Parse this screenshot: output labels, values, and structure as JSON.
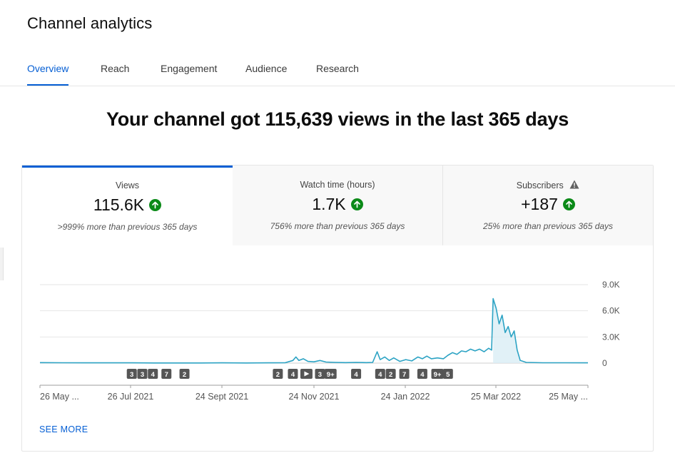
{
  "page": {
    "title": "Channel analytics"
  },
  "tabs": [
    {
      "label": "Overview",
      "active": true
    },
    {
      "label": "Reach",
      "active": false
    },
    {
      "label": "Engagement",
      "active": false
    },
    {
      "label": "Audience",
      "active": false
    },
    {
      "label": "Research",
      "active": false
    }
  ],
  "headline": "Your channel got 115,639 views in the last 365 days",
  "metrics": [
    {
      "label": "Views",
      "value": "115.6K",
      "trend": "up",
      "comparison": ">999% more than previous 365 days",
      "warning": false
    },
    {
      "label": "Watch time (hours)",
      "value": "1.7K",
      "trend": "up",
      "comparison": "756% more than previous 365 days",
      "warning": false
    },
    {
      "label": "Subscribers",
      "value": "+187",
      "trend": "up",
      "comparison": "25% more than previous 365 days",
      "warning": true
    }
  ],
  "colors": {
    "accent": "#065fd4",
    "line": "#2ca3c4",
    "trend_up": "#0b8a18",
    "marker_bg": "#555555"
  },
  "chart_data": {
    "type": "line",
    "metric": "Views",
    "x_tick_labels": [
      "26 May ...",
      "26 Jul 2021",
      "24 Sept 2021",
      "24 Nov 2021",
      "24 Jan 2022",
      "25 Mar 2022",
      "25 May ..."
    ],
    "y_tick_labels": [
      "9.0K",
      "6.0K",
      "3.0K",
      "0"
    ],
    "ylim": [
      0,
      9000
    ],
    "grid": true,
    "x_start": "2021-05-26",
    "x_end": "2022-05-25",
    "series": [
      {
        "points": [
          [
            "2021-05-26",
            60
          ],
          [
            "2021-06-10",
            40
          ],
          [
            "2021-06-25",
            30
          ],
          [
            "2021-07-10",
            30
          ],
          [
            "2021-07-26",
            30
          ],
          [
            "2021-08-10",
            20
          ],
          [
            "2021-08-25",
            20
          ],
          [
            "2021-09-10",
            20
          ],
          [
            "2021-09-24",
            30
          ],
          [
            "2021-10-10",
            20
          ],
          [
            "2021-10-25",
            30
          ],
          [
            "2021-11-05",
            50
          ],
          [
            "2021-11-10",
            300
          ],
          [
            "2021-11-12",
            700
          ],
          [
            "2021-11-14",
            300
          ],
          [
            "2021-11-17",
            500
          ],
          [
            "2021-11-20",
            200
          ],
          [
            "2021-11-24",
            150
          ],
          [
            "2021-11-28",
            300
          ],
          [
            "2021-12-02",
            120
          ],
          [
            "2021-12-08",
            80
          ],
          [
            "2021-12-15",
            60
          ],
          [
            "2021-12-22",
            80
          ],
          [
            "2021-12-29",
            60
          ],
          [
            "2022-01-02",
            80
          ],
          [
            "2022-01-05",
            1300
          ],
          [
            "2022-01-07",
            400
          ],
          [
            "2022-01-10",
            700
          ],
          [
            "2022-01-13",
            300
          ],
          [
            "2022-01-16",
            600
          ],
          [
            "2022-01-20",
            200
          ],
          [
            "2022-01-24",
            400
          ],
          [
            "2022-01-28",
            250
          ],
          [
            "2022-02-01",
            700
          ],
          [
            "2022-02-04",
            500
          ],
          [
            "2022-02-07",
            800
          ],
          [
            "2022-02-10",
            500
          ],
          [
            "2022-02-14",
            600
          ],
          [
            "2022-02-18",
            500
          ],
          [
            "2022-02-21",
            900
          ],
          [
            "2022-02-24",
            1200
          ],
          [
            "2022-02-27",
            1000
          ],
          [
            "2022-03-02",
            1400
          ],
          [
            "2022-03-05",
            1300
          ],
          [
            "2022-03-08",
            1600
          ],
          [
            "2022-03-11",
            1400
          ],
          [
            "2022-03-14",
            1600
          ],
          [
            "2022-03-17",
            1300
          ],
          [
            "2022-03-20",
            1700
          ],
          [
            "2022-03-22",
            1500
          ],
          [
            "2022-03-23",
            7400
          ],
          [
            "2022-03-25",
            6300
          ],
          [
            "2022-03-27",
            4500
          ],
          [
            "2022-03-29",
            5500
          ],
          [
            "2022-03-31",
            3500
          ],
          [
            "2022-04-02",
            4200
          ],
          [
            "2022-04-04",
            3000
          ],
          [
            "2022-04-06",
            3700
          ],
          [
            "2022-04-08",
            1500
          ],
          [
            "2022-04-10",
            300
          ],
          [
            "2022-04-14",
            80
          ],
          [
            "2022-04-25",
            40
          ],
          [
            "2022-05-10",
            40
          ],
          [
            "2022-05-25",
            30
          ]
        ]
      }
    ],
    "shaded_range": [
      "2022-03-23",
      "2022-04-10"
    ],
    "annotations": [
      {
        "date": "2021-07-26",
        "label": "3"
      },
      {
        "date": "2021-08-02",
        "label": "3"
      },
      {
        "date": "2021-08-09",
        "label": "4"
      },
      {
        "date": "2021-08-18",
        "label": "7"
      },
      {
        "date": "2021-08-30",
        "label": "2"
      },
      {
        "date": "2021-10-31",
        "label": "2"
      },
      {
        "date": "2021-11-10",
        "label": "4"
      },
      {
        "date": "2021-11-19",
        "label": "play"
      },
      {
        "date": "2021-11-28",
        "label": "3"
      },
      {
        "date": "2021-12-05",
        "label": "9+"
      },
      {
        "date": "2021-12-22",
        "label": "4"
      },
      {
        "date": "2022-01-07",
        "label": "4"
      },
      {
        "date": "2022-01-14",
        "label": "2"
      },
      {
        "date": "2022-01-23",
        "label": "7"
      },
      {
        "date": "2022-02-04",
        "label": "4"
      },
      {
        "date": "2022-02-14",
        "label": "9+"
      },
      {
        "date": "2022-02-21",
        "label": "5"
      }
    ]
  },
  "actions": {
    "see_more": "SEE MORE"
  }
}
